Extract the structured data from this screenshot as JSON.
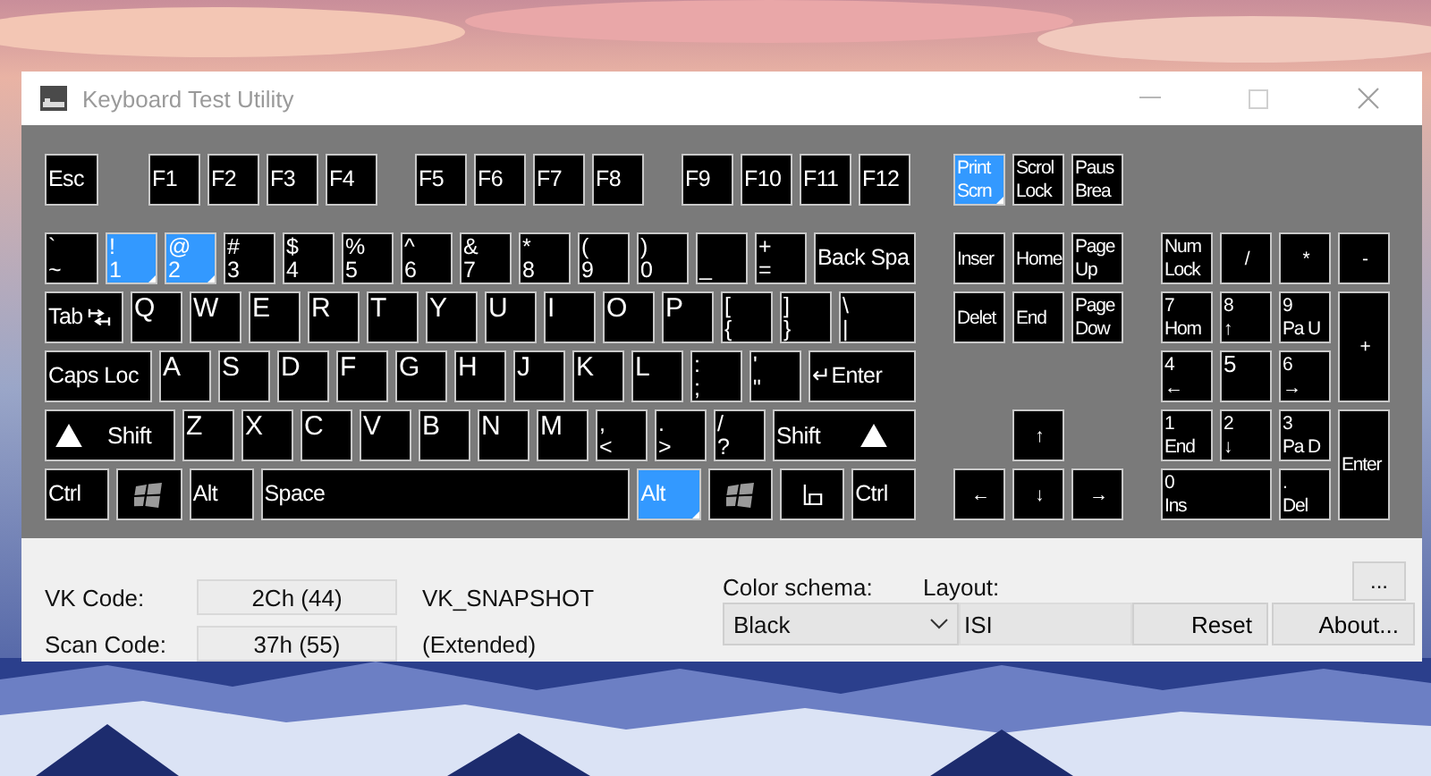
{
  "window": {
    "title": "Keyboard Test Utility"
  },
  "keyboard": {
    "main_rows": [
      [
        {
          "kind": "label",
          "legend": [
            "Esc"
          ],
          "pressed": false
        },
        {
          "kind": "label",
          "legend": [
            "F1"
          ],
          "pressed": false
        },
        {
          "kind": "label",
          "legend": [
            "F2"
          ],
          "pressed": false
        },
        {
          "kind": "label",
          "legend": [
            "F3"
          ],
          "pressed": false
        },
        {
          "kind": "label",
          "legend": [
            "F4"
          ],
          "pressed": false
        },
        {
          "kind": "label",
          "legend": [
            "F5"
          ],
          "pressed": false
        },
        {
          "kind": "label",
          "legend": [
            "F6"
          ],
          "pressed": false
        },
        {
          "kind": "label",
          "legend": [
            "F7"
          ],
          "pressed": false
        },
        {
          "kind": "label",
          "legend": [
            "F8"
          ],
          "pressed": false
        },
        {
          "kind": "label",
          "legend": [
            "F9"
          ],
          "pressed": false
        },
        {
          "kind": "label",
          "legend": [
            "F10"
          ],
          "pressed": false
        },
        {
          "kind": "label",
          "legend": [
            "F11"
          ],
          "pressed": false
        },
        {
          "kind": "label",
          "legend": [
            "F12"
          ],
          "pressed": false
        }
      ],
      [
        {
          "kind": "dual",
          "legend": [
            "`",
            "~"
          ],
          "pressed": false
        },
        {
          "kind": "dual",
          "legend": [
            "!",
            "1"
          ],
          "pressed": true
        },
        {
          "kind": "dual",
          "legend": [
            "@",
            "2"
          ],
          "pressed": true
        },
        {
          "kind": "dual",
          "legend": [
            "#",
            "3"
          ],
          "pressed": false
        },
        {
          "kind": "dual",
          "legend": [
            "$",
            "4"
          ],
          "pressed": false
        },
        {
          "kind": "dual",
          "legend": [
            "%",
            "5"
          ],
          "pressed": false
        },
        {
          "kind": "dual",
          "legend": [
            "^",
            "6"
          ],
          "pressed": false
        },
        {
          "kind": "dual",
          "legend": [
            "&",
            "7"
          ],
          "pressed": false
        },
        {
          "kind": "dual",
          "legend": [
            "*",
            "8"
          ],
          "pressed": false
        },
        {
          "kind": "dual",
          "legend": [
            "(",
            "9"
          ],
          "pressed": false
        },
        {
          "kind": "dual",
          "legend": [
            ")",
            "0"
          ],
          "pressed": false
        },
        {
          "kind": "bottom",
          "legend": [
            "_"
          ],
          "pressed": false
        },
        {
          "kind": "dual",
          "legend": [
            "+",
            "="
          ],
          "pressed": false
        },
        {
          "kind": "label",
          "legend": [
            "Back Spa"
          ],
          "pressed": false
        }
      ],
      [
        {
          "kind": "tab",
          "legend": [
            "Tab"
          ],
          "pressed": false
        },
        {
          "kind": "letter",
          "legend": [
            "Q"
          ],
          "pressed": false
        },
        {
          "kind": "letter",
          "legend": [
            "W"
          ],
          "pressed": false
        },
        {
          "kind": "letter",
          "legend": [
            "E"
          ],
          "pressed": false
        },
        {
          "kind": "letter",
          "legend": [
            "R"
          ],
          "pressed": false
        },
        {
          "kind": "letter",
          "legend": [
            "T"
          ],
          "pressed": false
        },
        {
          "kind": "letter",
          "legend": [
            "Y"
          ],
          "pressed": false
        },
        {
          "kind": "letter",
          "legend": [
            "U"
          ],
          "pressed": false
        },
        {
          "kind": "letter",
          "legend": [
            "I"
          ],
          "pressed": false
        },
        {
          "kind": "letter",
          "legend": [
            "O"
          ],
          "pressed": false
        },
        {
          "kind": "letter",
          "legend": [
            "P"
          ],
          "pressed": false
        },
        {
          "kind": "dual",
          "legend": [
            "[",
            "{"
          ],
          "pressed": false
        },
        {
          "kind": "dual",
          "legend": [
            "]",
            "}"
          ],
          "pressed": false
        },
        {
          "kind": "dual",
          "legend": [
            "\\",
            "|"
          ],
          "pressed": false
        }
      ],
      [
        {
          "kind": "label",
          "legend": [
            "Caps Loc"
          ],
          "pressed": false
        },
        {
          "kind": "letter",
          "legend": [
            "A"
          ],
          "pressed": false
        },
        {
          "kind": "letter",
          "legend": [
            "S"
          ],
          "pressed": false
        },
        {
          "kind": "letter",
          "legend": [
            "D"
          ],
          "pressed": false
        },
        {
          "kind": "letter",
          "legend": [
            "F"
          ],
          "pressed": false
        },
        {
          "kind": "letter",
          "legend": [
            "G"
          ],
          "pressed": false
        },
        {
          "kind": "letter",
          "legend": [
            "H"
          ],
          "pressed": false
        },
        {
          "kind": "letter",
          "legend": [
            "J"
          ],
          "pressed": false
        },
        {
          "kind": "letter",
          "legend": [
            "K"
          ],
          "pressed": false
        },
        {
          "kind": "letter",
          "legend": [
            "L"
          ],
          "pressed": false
        },
        {
          "kind": "dual",
          "legend": [
            ":",
            ";"
          ],
          "pressed": false
        },
        {
          "kind": "dual",
          "legend": [
            "'",
            "\""
          ],
          "pressed": false
        },
        {
          "kind": "label",
          "legend": [
            "↵Enter"
          ],
          "pressed": false
        }
      ],
      [
        {
          "kind": "lshift",
          "legend": [
            "Shift"
          ],
          "pressed": false
        },
        {
          "kind": "letter",
          "legend": [
            "Z"
          ],
          "pressed": false
        },
        {
          "kind": "letter",
          "legend": [
            "X"
          ],
          "pressed": false
        },
        {
          "kind": "letter",
          "legend": [
            "C"
          ],
          "pressed": false
        },
        {
          "kind": "letter",
          "legend": [
            "V"
          ],
          "pressed": false
        },
        {
          "kind": "letter",
          "legend": [
            "B"
          ],
          "pressed": false
        },
        {
          "kind": "letter",
          "legend": [
            "N"
          ],
          "pressed": false
        },
        {
          "kind": "letter",
          "legend": [
            "M"
          ],
          "pressed": false
        },
        {
          "kind": "dual",
          "legend": [
            ",",
            "<"
          ],
          "pressed": false
        },
        {
          "kind": "dual",
          "legend": [
            ".",
            ">"
          ],
          "pressed": false
        },
        {
          "kind": "dual",
          "legend": [
            "/",
            "?"
          ],
          "pressed": false
        },
        {
          "kind": "rshift",
          "legend": [
            "Shift"
          ],
          "pressed": false
        }
      ],
      [
        {
          "kind": "label",
          "legend": [
            "Ctrl"
          ],
          "pressed": false
        },
        {
          "kind": "windows",
          "pressed": false
        },
        {
          "kind": "label",
          "legend": [
            "Alt"
          ],
          "pressed": false
        },
        {
          "kind": "label",
          "legend": [
            "Space"
          ],
          "pressed": false
        },
        {
          "kind": "label",
          "legend": [
            "Alt"
          ],
          "pressed": true
        },
        {
          "kind": "windows",
          "pressed": false
        },
        {
          "kind": "menu",
          "pressed": false
        },
        {
          "kind": "label",
          "legend": [
            "Ctrl"
          ],
          "pressed": false
        }
      ]
    ],
    "nav_keys": [
      {
        "kind": "dual",
        "legend": [
          "Print",
          "Scrn"
        ],
        "pressed": true
      },
      {
        "kind": "dual",
        "legend": [
          "Scrol",
          "Lock"
        ],
        "pressed": false
      },
      {
        "kind": "dual",
        "legend": [
          "Paus",
          "Brea"
        ],
        "pressed": false
      },
      {
        "kind": "label",
        "legend": [
          "Inser"
        ],
        "pressed": false
      },
      {
        "kind": "label",
        "legend": [
          "Home"
        ],
        "pressed": false
      },
      {
        "kind": "dual",
        "legend": [
          "Page",
          "Up"
        ],
        "pressed": false
      },
      {
        "kind": "label",
        "legend": [
          "Delet"
        ],
        "pressed": false
      },
      {
        "kind": "label",
        "legend": [
          "End"
        ],
        "pressed": false
      },
      {
        "kind": "dual",
        "legend": [
          "Page",
          "Dow"
        ],
        "pressed": false
      },
      {
        "kind": "symbol",
        "legend": [
          "↑"
        ],
        "pressed": false
      },
      {
        "kind": "symbol",
        "legend": [
          "←"
        ],
        "pressed": false
      },
      {
        "kind": "symbol",
        "legend": [
          "↓"
        ],
        "pressed": false
      },
      {
        "kind": "symbol",
        "legend": [
          "→"
        ],
        "pressed": false
      }
    ],
    "numpad_keys": [
      {
        "kind": "dual",
        "legend": [
          "Num",
          "Lock"
        ],
        "pressed": false
      },
      {
        "kind": "symbol",
        "legend": [
          "/"
        ],
        "pressed": false
      },
      {
        "kind": "symbol",
        "legend": [
          "*"
        ],
        "pressed": false
      },
      {
        "kind": "symbol",
        "legend": [
          "-"
        ],
        "pressed": false
      },
      {
        "kind": "dual",
        "legend": [
          "7",
          "Hom"
        ],
        "pressed": false
      },
      {
        "kind": "dual",
        "legend": [
          "8",
          "↑"
        ],
        "pressed": false
      },
      {
        "kind": "dual",
        "legend": [
          "9",
          "Pa U"
        ],
        "pressed": false
      },
      {
        "kind": "symbol",
        "legend": [
          "+"
        ],
        "pressed": false
      },
      {
        "kind": "dual",
        "legend": [
          "4",
          "←"
        ],
        "pressed": false
      },
      {
        "kind": "letter",
        "legend": [
          "5"
        ],
        "pressed": false
      },
      {
        "kind": "dual",
        "legend": [
          "6",
          "→"
        ],
        "pressed": false
      },
      {
        "kind": "dual",
        "legend": [
          "1",
          "End"
        ],
        "pressed": false
      },
      {
        "kind": "dual",
        "legend": [
          "2",
          "↓"
        ],
        "pressed": false
      },
      {
        "kind": "dual",
        "legend": [
          "3",
          "Pa D"
        ],
        "pressed": false
      },
      {
        "kind": "label",
        "legend": [
          "Enter"
        ],
        "pressed": false
      },
      {
        "kind": "dual",
        "legend": [
          "0",
          "Ins"
        ],
        "pressed": false
      },
      {
        "kind": "dual",
        "legend": [
          ".",
          "Del"
        ],
        "pressed": false
      }
    ]
  },
  "info": {
    "vk_code_label": "VK Code:",
    "vk_code": "2Ch (44)",
    "vk_name": "VK_SNAPSHOT",
    "scan_code_label": "Scan Code:",
    "scan_code": "37h (55)",
    "scan_note": "(Extended)",
    "color_schema_label": "Color schema:",
    "color_schema": "Black",
    "layout_label": "Layout:",
    "layout": "ISI",
    "more_button": "...",
    "reset_button": "Reset",
    "about_button": "About..."
  }
}
